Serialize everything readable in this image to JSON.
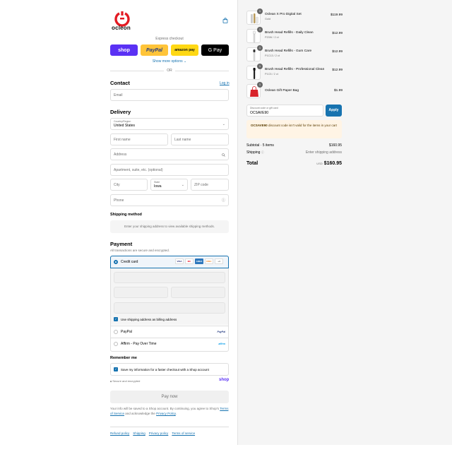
{
  "brand": {
    "name": "ocleon",
    "accent": "#e31b23"
  },
  "express": {
    "label": "Express checkout",
    "buttons": {
      "shop": "shop",
      "paypal": "PayPal",
      "amazon": "amazon pay",
      "gpay": "G Pay"
    },
    "show_more": "Show more options ⌄",
    "or": "OR"
  },
  "contact": {
    "title": "Contact",
    "login": "Log in",
    "email_placeholder": "Email"
  },
  "delivery": {
    "title": "Delivery",
    "country_label": "Country/Region",
    "country_value": "United States",
    "first_name": "First name",
    "last_name": "Last name",
    "address": "Address",
    "apartment": "Apartment, suite, etc. (optional)",
    "city": "City",
    "state_label": "State",
    "state_value": "Iowa",
    "zip": "ZIP code",
    "phone": "Phone"
  },
  "shipping_method": {
    "title": "Shipping method",
    "note": "Enter your shipping address to view available shipping methods."
  },
  "payment": {
    "title": "Payment",
    "subtitle": "All transactions are secure and encrypted.",
    "credit_card": "Credit card",
    "card_logos": [
      "VISA",
      "MC",
      "AMEX",
      "DISC",
      "+4"
    ],
    "billing_same": "Use shipping address as billing address",
    "paypal": "PayPal",
    "paypal_logo": "PayPal",
    "affirm": "Affirm - Pay Over Time",
    "affirm_logo": "affirm"
  },
  "remember": {
    "title": "Remember me",
    "save_label": "Save my information for a faster checkout with a Shop account",
    "secure": "Secure and encrypted",
    "shop_logo": "shop"
  },
  "pay_now": "Pay now",
  "legal": {
    "text1": "Your info will be saved to a Shop account. By continuing, you agree to Shop's",
    "terms": "Terms of Service",
    "text2": "and acknowledge the",
    "privacy": "Privacy Policy",
    "end": "."
  },
  "footer_links": [
    "Refund policy",
    "Shipping",
    "Privacy policy",
    "Terms of service"
  ],
  "cart": {
    "items": [
      {
        "name": "Oclean X Pro Digital Set",
        "sub": "Gold",
        "qty": "1",
        "price": "$119.99"
      },
      {
        "name": "Brush Head Refills - Daily Clean",
        "sub": "P20W / 2 ct",
        "qty": "1",
        "price": "$12.99"
      },
      {
        "name": "Brush Head Refills - Gum Care",
        "sub": "P1C13 / 2 ct",
        "qty": "1",
        "price": "$12.99"
      },
      {
        "name": "Brush Head Refills - Professional Clean",
        "sub": "P1C5 / 2 ct",
        "qty": "1",
        "price": "$12.99"
      },
      {
        "name": "Oclean Gift Paper Bag",
        "sub": "",
        "qty": "1",
        "price": "$1.99"
      }
    ],
    "discount_label": "Discount code or gift card",
    "discount_value": "OCSAVE90",
    "apply": "Apply",
    "warning_code": "OCSAVE90",
    "warning_text": "discount code isn't valid for the items in your cart",
    "subtotal_label": "Subtotal · 5 items",
    "subtotal_value": "$160.95",
    "shipping_label": "Shipping",
    "shipping_value": "Enter shipping address",
    "total_label": "Total",
    "currency": "USD",
    "total_value": "$160.95"
  }
}
